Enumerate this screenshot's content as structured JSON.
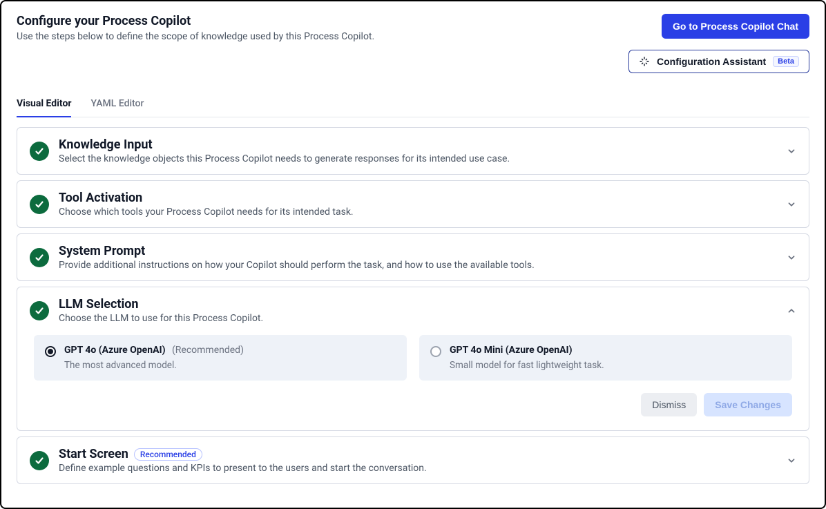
{
  "header": {
    "title": "Configure your Process Copilot",
    "subtitle": "Use the steps below to define the scope of knowledge used by this Process Copilot.",
    "chat_button": "Go to Process Copilot Chat",
    "assistant_button": "Configuration Assistant",
    "assistant_badge": "Beta"
  },
  "tabs": {
    "visual": "Visual Editor",
    "yaml": "YAML Editor"
  },
  "sections": {
    "knowledge": {
      "title": "Knowledge Input",
      "desc": "Select the knowledge objects this Process Copilot needs to generate responses for its intended use case."
    },
    "tool": {
      "title": "Tool Activation",
      "desc": "Choose which tools your Process Copilot needs for its intended task."
    },
    "prompt": {
      "title": "System Prompt",
      "desc": "Provide additional instructions on how your Copilot should perform the task, and how to use the available tools."
    },
    "llm": {
      "title": "LLM Selection",
      "desc": "Choose the LLM to use for this Process Copilot.",
      "option1_name": "GPT 4o (Azure OpenAI)",
      "option1_rec": "(Recommended)",
      "option1_desc": "The most advanced model.",
      "option2_name": "GPT 4o Mini (Azure OpenAI)",
      "option2_desc": "Small model for fast lightweight task.",
      "dismiss": "Dismiss",
      "save": "Save Changes"
    },
    "start": {
      "title": "Start Screen",
      "badge": "Recommended",
      "desc": "Define example questions and KPIs to present to the users and start the conversation."
    }
  }
}
